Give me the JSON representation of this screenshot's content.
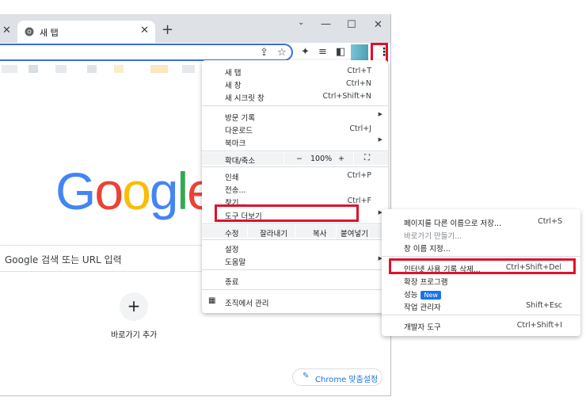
{
  "browser": {
    "tab_title": "새 탭",
    "search_placeholder": "Google 검색 또는 URL 입력",
    "google_logo": "Google",
    "add_shortcut_label": "바로가기 추가",
    "customize_label": "Chrome 맞춤설정",
    "colors": {
      "highlight_border": "#e0102c",
      "accent": "#1a73e8"
    }
  },
  "menu": {
    "new_tab": {
      "label": "새 탭",
      "shortcut": "Ctrl+T"
    },
    "new_window": {
      "label": "새 창",
      "shortcut": "Ctrl+N"
    },
    "new_incognito": {
      "label": "새 시크릿 창",
      "shortcut": "Ctrl+Shift+N"
    },
    "history": {
      "label": "방문 기록"
    },
    "downloads": {
      "label": "다운로드",
      "shortcut": "Ctrl+J"
    },
    "bookmarks": {
      "label": "북마크"
    },
    "zoom": {
      "label": "확대/축소",
      "minus": "−",
      "value": "100%",
      "plus": "+"
    },
    "print": {
      "label": "인쇄",
      "shortcut": "Ctrl+P"
    },
    "cast": {
      "label": "전송..."
    },
    "find": {
      "label": "찾기...",
      "shortcut": "Ctrl+F"
    },
    "more_tools": {
      "label": "도구 더보기"
    },
    "edit": {
      "label": "수정",
      "cut": "잘라내기",
      "copy": "복사",
      "paste": "붙여넣기"
    },
    "settings": {
      "label": "설정"
    },
    "help": {
      "label": "도움말"
    },
    "exit": {
      "label": "종료"
    },
    "managed": {
      "label": "조직에서 관리"
    }
  },
  "submenu": {
    "save_page": {
      "label": "페이지를 다른 이름으로 저장...",
      "shortcut": "Ctrl+S"
    },
    "create_shortcut": {
      "label": "바로가기 만들기..."
    },
    "name_window": {
      "label": "창 이름 지정..."
    },
    "clear_browsing": {
      "label": "인터넷 사용 기록 삭제...",
      "shortcut": "Ctrl+Shift+Del"
    },
    "extensions": {
      "label": "확장 프로그램"
    },
    "performance": {
      "label": "성능",
      "badge": "New"
    },
    "task_manager": {
      "label": "작업 관리자",
      "shortcut": "Shift+Esc"
    },
    "dev_tools": {
      "label": "개발자 도구",
      "shortcut": "Ctrl+Shift+I"
    }
  }
}
